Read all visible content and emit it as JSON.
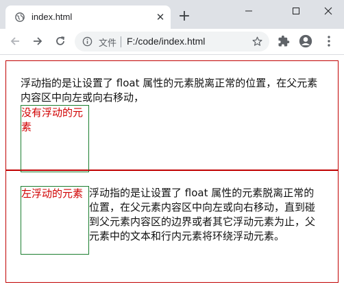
{
  "browser": {
    "tab_title": "index.html",
    "scheme_label": "文件",
    "url": "F:/code/index.html"
  },
  "page": {
    "section1": {
      "text": "浮动指的是让设置了 float 属性的元素脱离正常的位置，在父元素内容区中向左或向右移动，",
      "box_label": "没有浮动的元素"
    },
    "section2": {
      "text": "浮动指的是让设置了 float 属性的元素脱离正常的位置，在父元素内容区中向左或向右移动，直到碰到父元素内容区的边界或者其它浮动元素为止，父元素中的文本和行内元素将环绕浮动元素。",
      "box_label": "左浮动的元素"
    }
  },
  "colors": {
    "section_border": "#c00000",
    "box_border": "#1a7d2e",
    "box_text": "#d00000"
  }
}
